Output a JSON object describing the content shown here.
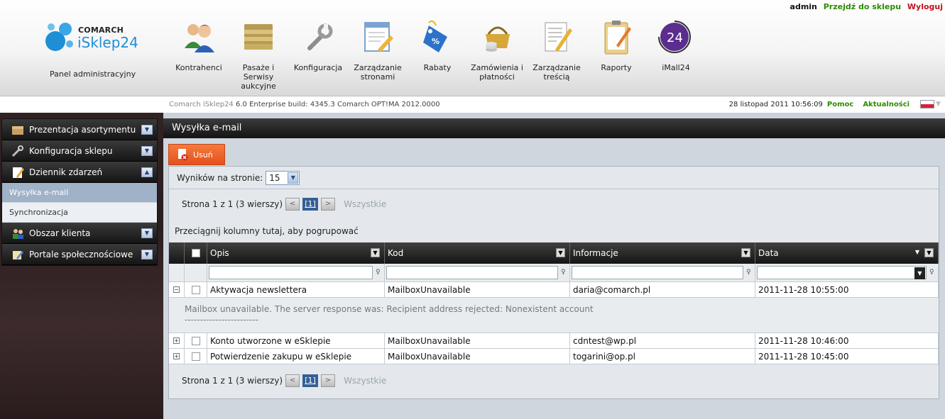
{
  "header": {
    "user": "admin",
    "go_to_shop": "Przejdź do sklepu",
    "logout": "Wyloguj",
    "logo_brand": "COMARCH",
    "logo_product": "iSklep24",
    "panel_title": "Panel administracyjny",
    "nav": [
      {
        "label": "Kontrahenci",
        "icon": "users-icon"
      },
      {
        "label": "Pasaże i Serwisy aukcyjne",
        "icon": "folder-icon"
      },
      {
        "label": "Konfiguracja",
        "icon": "wrench-icon"
      },
      {
        "label": "Zarządzanie stronami",
        "icon": "page-edit-icon"
      },
      {
        "label": "Rabaty",
        "icon": "discount-tag-icon"
      },
      {
        "label": "Zamówienia i płatności",
        "icon": "basket-icon"
      },
      {
        "label": "Zarządzanie treścią",
        "icon": "document-pencil-icon"
      },
      {
        "label": "Raporty",
        "icon": "clipboard-icon"
      },
      {
        "label": "iMall24",
        "icon": "imall24-icon",
        "badge": "24"
      }
    ]
  },
  "infobar": {
    "build_name": "Comarch iSklep24",
    "build_info": "6.0 Enterprise build: 4345.3  Comarch OPT!MA 2012.0000",
    "datetime": "28 listopad 2011 10:56:09",
    "help": "Pomoc",
    "news": "Aktualności"
  },
  "sidebar": {
    "sections": [
      {
        "label": "Prezentacja asortymentu",
        "expanded": false
      },
      {
        "label": "Konfiguracja sklepu",
        "expanded": false
      },
      {
        "label": "Dziennik zdarzeń",
        "expanded": true,
        "items": [
          "Wysyłka e-mail",
          "Synchronizacja"
        ],
        "active_item": "Wysyłka e-mail"
      },
      {
        "label": "Obszar klienta",
        "expanded": false
      },
      {
        "label": "Portale społecznościowe",
        "expanded": false
      }
    ]
  },
  "main": {
    "title": "Wysyłka e-mail",
    "delete_button": "Usuń",
    "results_per_page_label": "Wyników na stronie:",
    "results_per_page_value": "15",
    "pager": {
      "text": "Strona 1 z 1 (3 wierszy)",
      "prev": "<",
      "current": "[1]",
      "next": ">",
      "all": "Wszystkie"
    },
    "group_hint": "Przeciągnij kolumny tutaj, aby pogrupować",
    "columns": [
      "Opis",
      "Kod",
      "Informacje",
      "Data"
    ],
    "rows": [
      {
        "expanded": true,
        "opis": "Aktywacja newslettera",
        "kod": "MailboxUnavailable",
        "informacje": "daria@comarch.pl",
        "data": "2011-11-28 10:55:00",
        "detail_line1": "Mailbox unavailable. The server response was: Recipient address rejected: Nonexistent account",
        "detail_line2": "------------------------"
      },
      {
        "expanded": false,
        "opis": "Konto utworzone w eSklepie",
        "kod": "MailboxUnavailable",
        "informacje": "cdntest@wp.pl",
        "data": "2011-11-28 10:46:00"
      },
      {
        "expanded": false,
        "opis": "Potwierdzenie zakupu w eSklepie",
        "kod": "MailboxUnavailable",
        "informacje": "togarini@op.pl",
        "data": "2011-11-28 10:45:00"
      }
    ]
  },
  "colors": {
    "link_green": "#2e8b00",
    "logout_red": "#c8101a",
    "delete_orange": "#e4511d",
    "accent_blue": "#1e8fd6",
    "sidebar_active": "#9fb2c7"
  }
}
